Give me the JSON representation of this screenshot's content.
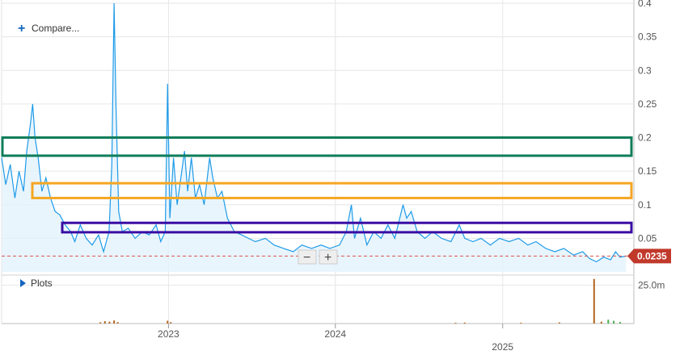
{
  "toolbar": {
    "compare_label": "Compare...",
    "plots_label": "Plots",
    "zoom_out_symbol": "−",
    "zoom_in_symbol": "+",
    "plus_icon": "plus-icon",
    "triangle_icon": "triangle-right-icon"
  },
  "colors": {
    "price_line": "#1e9be8",
    "price_fill": "#e3f2fd",
    "current_price_badge": "#c0392b",
    "volume_bar": "#b5651d",
    "volume_bar_green": "#4caf50",
    "reference_line": "#d9534f",
    "grid": "#e6e6e6",
    "band_green": "#0e7d5a",
    "band_orange": "#f5a623",
    "band_purple": "#3a0ca3"
  },
  "chart_data": [
    {
      "type": "line",
      "title": "",
      "xlabel": "",
      "ylabel": "",
      "x_tick_labels": [
        "2023",
        "2024",
        "2025"
      ],
      "y_tick_labels": [
        "0.4",
        "0.35",
        "0.3",
        "0.25",
        "0.2",
        "0.15",
        "0.1",
        "0.05"
      ],
      "y_ticks": [
        0.4,
        0.35,
        0.3,
        0.25,
        0.2,
        0.15,
        0.1,
        0.05
      ],
      "ylim": [
        0.0,
        0.4
      ],
      "xlim": [
        "2022-01-01",
        "2025-10-15"
      ],
      "grid": true,
      "fill": "area",
      "current_value_label": "0.0235",
      "current_value": 0.0235,
      "reference_line_value": 0.0235,
      "series": [
        {
          "points": [
            [
              "2022-01-01",
              0.17
            ],
            [
              "2022-01-10",
              0.13
            ],
            [
              "2022-01-20",
              0.16
            ],
            [
              "2022-01-30",
              0.11
            ],
            [
              "2022-02-08",
              0.15
            ],
            [
              "2022-02-18",
              0.12
            ],
            [
              "2022-02-25",
              0.18
            ],
            [
              "2022-03-05",
              0.22
            ],
            [
              "2022-03-10",
              0.25
            ],
            [
              "2022-03-15",
              0.2
            ],
            [
              "2022-03-22",
              0.17
            ],
            [
              "2022-03-30",
              0.12
            ],
            [
              "2022-04-08",
              0.14
            ],
            [
              "2022-04-18",
              0.11
            ],
            [
              "2022-04-28",
              0.09
            ],
            [
              "2022-05-08",
              0.085
            ],
            [
              "2022-05-20",
              0.07
            ],
            [
              "2022-06-01",
              0.06
            ],
            [
              "2022-06-10",
              0.045
            ],
            [
              "2022-06-22",
              0.07
            ],
            [
              "2022-07-05",
              0.05
            ],
            [
              "2022-07-18",
              0.04
            ],
            [
              "2022-08-01",
              0.055
            ],
            [
              "2022-08-12",
              0.03
            ],
            [
              "2022-08-24",
              0.06
            ],
            [
              "2022-08-30",
              0.16
            ],
            [
              "2022-09-04",
              0.4
            ],
            [
              "2022-09-08",
              0.25
            ],
            [
              "2022-09-14",
              0.09
            ],
            [
              "2022-09-22",
              0.06
            ],
            [
              "2022-10-05",
              0.065
            ],
            [
              "2022-10-20",
              0.05
            ],
            [
              "2022-11-05",
              0.06
            ],
            [
              "2022-11-20",
              0.055
            ],
            [
              "2022-12-05",
              0.07
            ],
            [
              "2022-12-15",
              0.045
            ],
            [
              "2022-12-25",
              0.06
            ],
            [
              "2022-12-30",
              0.28
            ],
            [
              "2023-01-04",
              0.08
            ],
            [
              "2023-01-12",
              0.17
            ],
            [
              "2023-01-20",
              0.1
            ],
            [
              "2023-01-28",
              0.14
            ],
            [
              "2023-02-05",
              0.18
            ],
            [
              "2023-02-12",
              0.12
            ],
            [
              "2023-02-20",
              0.17
            ],
            [
              "2023-03-01",
              0.11
            ],
            [
              "2023-03-10",
              0.13
            ],
            [
              "2023-03-20",
              0.1
            ],
            [
              "2023-04-01",
              0.17
            ],
            [
              "2023-04-08",
              0.14
            ],
            [
              "2023-04-18",
              0.11
            ],
            [
              "2023-04-28",
              0.12
            ],
            [
              "2023-05-10",
              0.08
            ],
            [
              "2023-05-25",
              0.06
            ],
            [
              "2023-06-10",
              0.055
            ],
            [
              "2023-06-25",
              0.05
            ],
            [
              "2023-07-10",
              0.045
            ],
            [
              "2023-08-01",
              0.05
            ],
            [
              "2023-08-20",
              0.04
            ],
            [
              "2023-09-10",
              0.035
            ],
            [
              "2023-10-01",
              0.03
            ],
            [
              "2023-10-20",
              0.04
            ],
            [
              "2023-11-10",
              0.035
            ],
            [
              "2023-12-01",
              0.04
            ],
            [
              "2023-12-20",
              0.035
            ],
            [
              "2024-01-10",
              0.04
            ],
            [
              "2024-01-25",
              0.06
            ],
            [
              "2024-02-05",
              0.1
            ],
            [
              "2024-02-12",
              0.05
            ],
            [
              "2024-02-25",
              0.08
            ],
            [
              "2024-03-10",
              0.04
            ],
            [
              "2024-03-25",
              0.06
            ],
            [
              "2024-04-10",
              0.05
            ],
            [
              "2024-04-25",
              0.07
            ],
            [
              "2024-05-10",
              0.05
            ],
            [
              "2024-05-28",
              0.1
            ],
            [
              "2024-06-05",
              0.08
            ],
            [
              "2024-06-15",
              0.09
            ],
            [
              "2024-06-28",
              0.06
            ],
            [
              "2024-07-15",
              0.05
            ],
            [
              "2024-08-01",
              0.06
            ],
            [
              "2024-08-20",
              0.05
            ],
            [
              "2024-09-10",
              0.045
            ],
            [
              "2024-09-28",
              0.07
            ],
            [
              "2024-10-10",
              0.05
            ],
            [
              "2024-10-28",
              0.045
            ],
            [
              "2024-11-15",
              0.05
            ],
            [
              "2024-12-05",
              0.04
            ],
            [
              "2024-12-25",
              0.05
            ],
            [
              "2025-01-15",
              0.045
            ],
            [
              "2025-02-05",
              0.05
            ],
            [
              "2025-02-25",
              0.04
            ],
            [
              "2025-03-15",
              0.045
            ],
            [
              "2025-04-05",
              0.035
            ],
            [
              "2025-04-25",
              0.03
            ],
            [
              "2025-05-15",
              0.035
            ],
            [
              "2025-06-05",
              0.025
            ],
            [
              "2025-06-25",
              0.03
            ],
            [
              "2025-07-10",
              0.02
            ],
            [
              "2025-07-25",
              0.015
            ],
            [
              "2025-08-10",
              0.022
            ],
            [
              "2025-08-25",
              0.018
            ],
            [
              "2025-09-05",
              0.03
            ],
            [
              "2025-09-15",
              0.022
            ],
            [
              "2025-09-28",
              0.0235
            ]
          ]
        }
      ]
    },
    {
      "type": "bar",
      "title": "",
      "xlabel": "",
      "ylabel": "",
      "y_tick_labels": [
        "25.0m"
      ],
      "y_ticks": [
        25000000
      ],
      "ylim": [
        0,
        32000000
      ],
      "values_note": "",
      "bars": [
        [
          "2022-08-05",
          800000
        ],
        [
          "2022-08-15",
          1500000
        ],
        [
          "2022-08-25",
          1200000
        ],
        [
          "2022-09-04",
          2000000
        ],
        [
          "2022-09-12",
          900000
        ],
        [
          "2022-12-30",
          1800000
        ],
        [
          "2023-01-06",
          900000
        ],
        [
          "2024-09-20",
          500000
        ],
        [
          "2024-10-10",
          600000
        ],
        [
          "2025-02-10",
          500000
        ],
        [
          "2025-05-05",
          700000
        ],
        [
          "2025-07-20",
          29000000
        ],
        [
          "2025-08-05",
          1200000
        ],
        [
          "2025-08-20",
          2500000
        ],
        [
          "2025-09-01",
          1800000
        ],
        [
          "2025-09-15",
          1000000
        ]
      ]
    }
  ],
  "highlight_bands": [
    {
      "name": "green",
      "y_range": [
        0.173,
        0.2
      ]
    },
    {
      "name": "orange",
      "y_range": [
        0.11,
        0.132
      ]
    },
    {
      "name": "purple",
      "y_range": [
        0.059,
        0.073
      ]
    }
  ]
}
